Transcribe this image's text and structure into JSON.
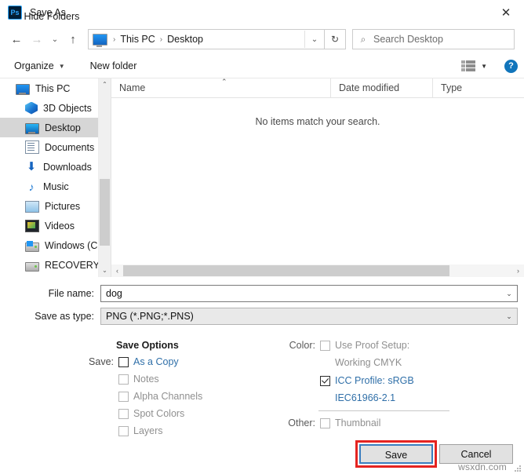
{
  "window": {
    "title": "Save As",
    "app_icon": "Ps",
    "close_icon": "✕"
  },
  "nav": {
    "back_icon": "←",
    "forward_icon": "→",
    "recent_icon": "⌄",
    "up_icon": "↑",
    "breadcrumbs": [
      "This PC",
      "Desktop"
    ],
    "separator": "›",
    "dropdown_icon": "⌄",
    "refresh_icon": "↻"
  },
  "search": {
    "icon": "⌕",
    "placeholder": "Search Desktop"
  },
  "commandbar": {
    "organize_label": "Organize",
    "organize_caret": "▼",
    "new_folder_label": "New folder",
    "view_caret": "▼",
    "help_label": "?"
  },
  "sidebar": {
    "items": [
      {
        "label": "This PC",
        "icon": "pc-icon",
        "indent": false,
        "selected": false
      },
      {
        "label": "3D Objects",
        "icon": "3d-objects-icon",
        "indent": true,
        "selected": false
      },
      {
        "label": "Desktop",
        "icon": "desktop-icon",
        "indent": true,
        "selected": true
      },
      {
        "label": "Documents",
        "icon": "documents-icon",
        "indent": true,
        "selected": false
      },
      {
        "label": "Downloads",
        "icon": "downloads-icon",
        "indent": true,
        "selected": false
      },
      {
        "label": "Music",
        "icon": "music-icon",
        "indent": true,
        "selected": false
      },
      {
        "label": "Pictures",
        "icon": "pictures-icon",
        "indent": true,
        "selected": false
      },
      {
        "label": "Videos",
        "icon": "videos-icon",
        "indent": true,
        "selected": false
      },
      {
        "label": "Windows (C:)",
        "icon": "drive-icon",
        "indent": true,
        "selected": false
      },
      {
        "label": "RECOVERY (D:)",
        "icon": "drive-icon",
        "indent": true,
        "selected": false
      }
    ],
    "scroll_up_icon": "⌃",
    "scroll_down_icon": "⌄"
  },
  "filelist": {
    "columns": [
      "Name",
      "Date modified",
      "Type"
    ],
    "sort_indicator": "⌃",
    "empty_message": "No items match your search.",
    "hscroll_left_icon": "‹",
    "hscroll_right_icon": "›"
  },
  "form": {
    "filename_label": "File name:",
    "filename_value": "dog",
    "filetype_label": "Save as type:",
    "filetype_value": "PNG (*.PNG;*.PNS)",
    "dropdown_icon": "⌄"
  },
  "save_options": {
    "section_title": "Save Options",
    "save_key": "Save:",
    "items": [
      {
        "label": "As a Copy",
        "checked": false,
        "enabled": true
      },
      {
        "label": "Notes",
        "checked": false,
        "enabled": false
      },
      {
        "label": "Alpha Channels",
        "checked": false,
        "enabled": false
      },
      {
        "label": "Spot Colors",
        "checked": false,
        "enabled": false
      },
      {
        "label": "Layers",
        "checked": false,
        "enabled": false
      }
    ]
  },
  "color_options": {
    "color_key": "Color:",
    "proof_label": "Use Proof Setup:",
    "proof_sub": "Working CMYK",
    "proof_checked": false,
    "icc_label": "ICC Profile:  sRGB",
    "icc_sub": "IEC61966-2.1",
    "icc_checked": true,
    "other_key": "Other:",
    "thumbnail_label": "Thumbnail",
    "thumbnail_checked": false
  },
  "footer": {
    "hide_folders_label": "Hide Folders",
    "hide_folders_caret": "⌃",
    "save_label": "Save",
    "cancel_label": "Cancel",
    "watermark": "wsxdn.com"
  },
  "colors": {
    "accent_blue": "#2f6fa8",
    "focus_border": "#3a7ebf",
    "annotation_red": "#e52421",
    "selection_gray": "#d6d6d6"
  }
}
